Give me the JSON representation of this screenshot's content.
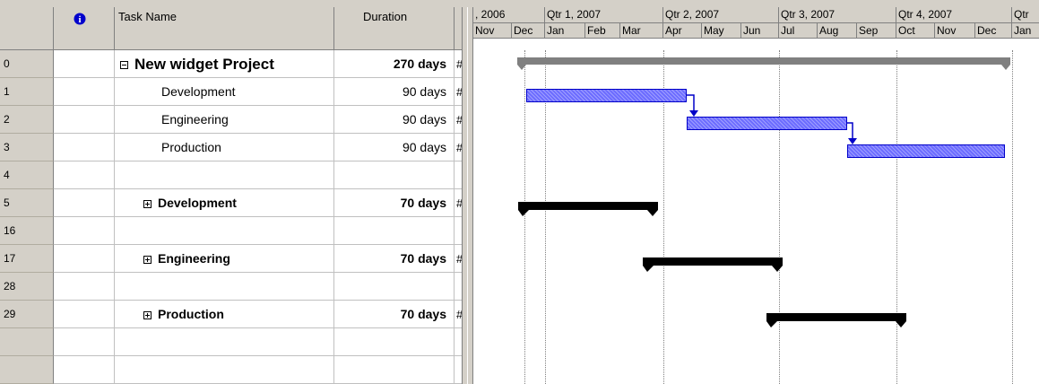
{
  "columns": {
    "info_icon": "i",
    "task_name": "Task Name",
    "duration": "Duration"
  },
  "timescale": {
    "major": [
      ", 2006",
      "Qtr 1, 2007",
      "Qtr 2, 2007",
      "Qtr 3, 2007",
      "Qtr 4, 2007",
      "Qtr"
    ],
    "minor": [
      "Nov",
      "Dec",
      "Jan",
      "Feb",
      "Mar",
      "Apr",
      "May",
      "Jun",
      "Jul",
      "Aug",
      "Sep",
      "Oct",
      "Nov",
      "Dec",
      "Jan"
    ]
  },
  "rows": [
    {
      "id": "0",
      "name": "New widget Project",
      "duration": "270 days",
      "hash": "#"
    },
    {
      "id": "1",
      "name": "Development",
      "duration": "90 days",
      "hash": "#"
    },
    {
      "id": "2",
      "name": "Engineering",
      "duration": "90 days",
      "hash": "#"
    },
    {
      "id": "3",
      "name": "Production",
      "duration": "90 days",
      "hash": "#"
    },
    {
      "id": "4",
      "name": "",
      "duration": "",
      "hash": ""
    },
    {
      "id": "5",
      "name": "Development",
      "duration": "70 days",
      "hash": "#"
    },
    {
      "id": "16",
      "name": "",
      "duration": "",
      "hash": ""
    },
    {
      "id": "17",
      "name": "Engineering",
      "duration": "70 days",
      "hash": "#"
    },
    {
      "id": "28",
      "name": "",
      "duration": "",
      "hash": ""
    },
    {
      "id": "29",
      "name": "Production",
      "duration": "70 days",
      "hash": "#"
    }
  ],
  "colors": {
    "header_bg": "#d4d0c8",
    "task_bar": "#6c6cff",
    "summary_bar": "#000000",
    "project_summary_bar": "#808080",
    "info_icon": "#0000cc"
  }
}
